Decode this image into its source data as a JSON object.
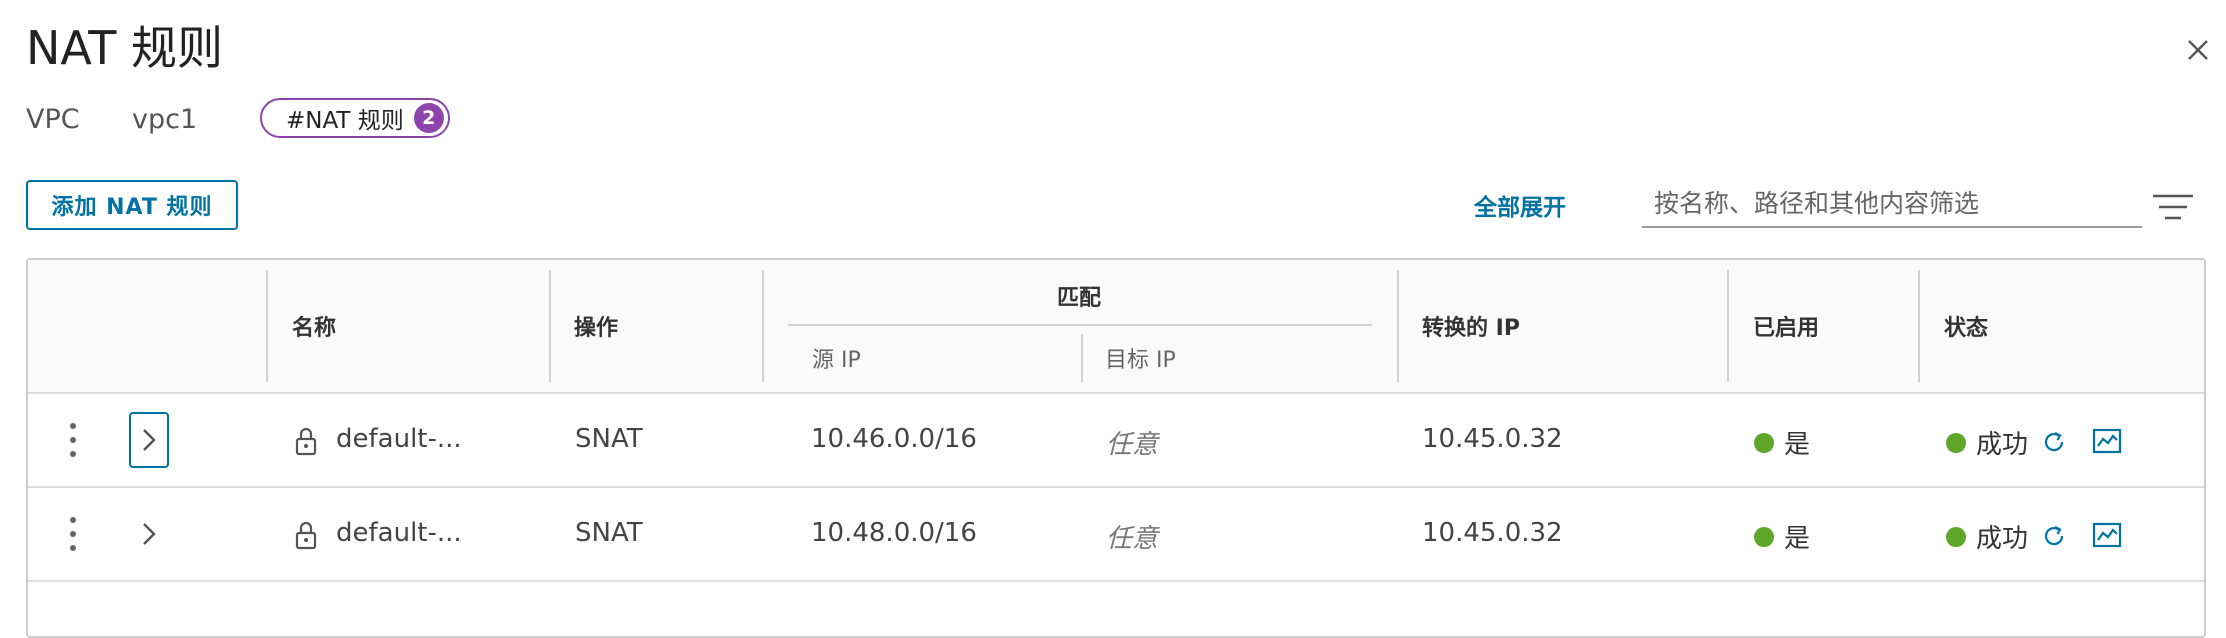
{
  "dialog": {
    "title": "NAT 规则",
    "close_icon": "close-icon"
  },
  "breadcrumb": {
    "vpc_label": "VPC",
    "vpc_name": "vpc1",
    "tag_label": "#NAT 规则",
    "tag_count": "2"
  },
  "toolbar": {
    "add_label": "添加 NAT 规则",
    "expand_all_label": "全部展开",
    "search_placeholder": "按名称、路径和其他内容筛选",
    "search_value": "",
    "filter_icon": "filter-icon"
  },
  "table": {
    "headers": {
      "name": "名称",
      "action": "操作",
      "match": "匹配",
      "source_ip": "源 IP",
      "dest_ip": "目标 IP",
      "translated_ip": "转换的 IP",
      "enabled": "已启用",
      "status": "状态"
    },
    "rows": [
      {
        "name": "default-...",
        "action": "SNAT",
        "source_ip": "10.46.0.0/16",
        "dest_ip": "任意",
        "translated_ip": "10.45.0.32",
        "enabled": "是",
        "status": "成功"
      },
      {
        "name": "default-...",
        "action": "SNAT",
        "source_ip": "10.48.0.0/16",
        "dest_ip": "任意",
        "translated_ip": "10.45.0.32",
        "enabled": "是",
        "status": "成功"
      }
    ]
  },
  "colors": {
    "accent": "#0072a3",
    "tag_purple": "#8e44ad",
    "success_green": "#5ea62a"
  }
}
